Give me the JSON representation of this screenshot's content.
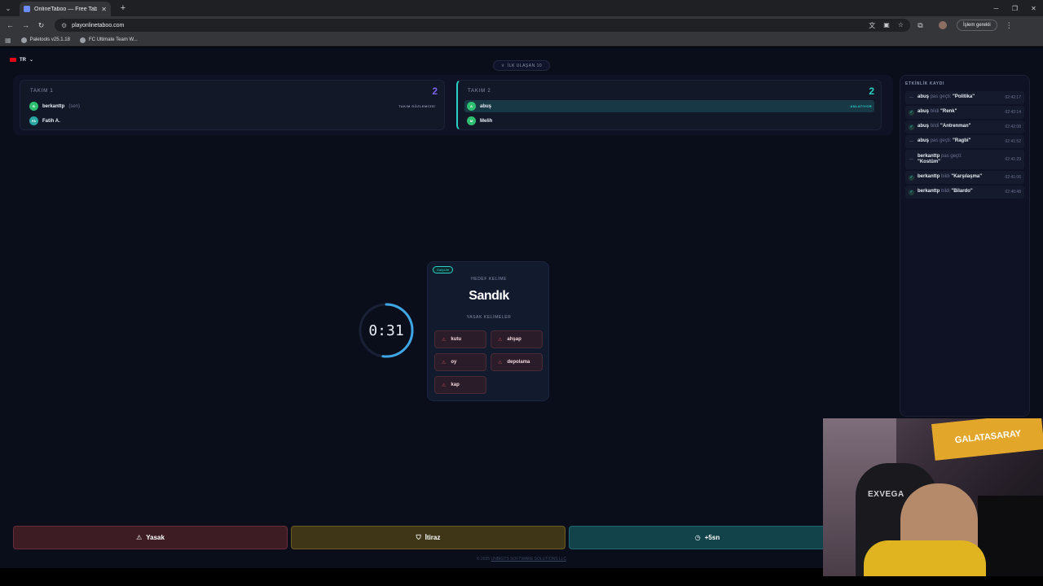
{
  "browser": {
    "tab_title": "OnlineTaboo — Free Taboo Ga",
    "url": "playonlinetaboo.com",
    "pending_label": "İşlem gerekli",
    "bookmarks": [
      "Paletools v25.1.18",
      "FC Ultimate Team W..."
    ]
  },
  "header": {
    "lang": "TR",
    "goal": "İLK ULAŞAN 10"
  },
  "teams": [
    {
      "name": "TAKIM 1",
      "score": "2",
      "color": "#7a64f2",
      "players": [
        {
          "initial": "B",
          "name": "berkanttp",
          "tag": "(sen)",
          "role": "TAKIM GÖZLEMCİSİ",
          "color": "#2fbf71"
        },
        {
          "initial": "FA",
          "name": "Fatih A.",
          "tag": "",
          "role": "",
          "color": "#2aa7a3"
        }
      ]
    },
    {
      "name": "TAKIM 2",
      "score": "2",
      "color": "#2ad1c4",
      "players": [
        {
          "initial": "A",
          "name": "abuş",
          "tag": "",
          "role": "ANLATIYOR",
          "color": "#2fbf71"
        },
        {
          "initial": "M",
          "name": "Melih",
          "tag": "",
          "role": "",
          "color": "#2fbf71"
        }
      ]
    }
  ],
  "log": {
    "title": "ETKİNLİK KAYDI",
    "items": [
      {
        "status": "pass",
        "user": "abuş",
        "action": "pas geçti:",
        "word": "\"Politika\"",
        "time": "02:42:17"
      },
      {
        "status": "ok",
        "user": "abuş",
        "action": "bildi",
        "word": "\"Renk\"",
        "time": "02:42:14"
      },
      {
        "status": "ok",
        "user": "abuş",
        "action": "bildi",
        "word": "\"Antrenman\"",
        "time": "02:42:08"
      },
      {
        "status": "pass",
        "user": "abuş",
        "action": "pas geçti:",
        "word": "\"Ragbi\"",
        "time": "02:41:52"
      },
      {
        "status": "pass",
        "user": "berkanttp",
        "action": "pas geçti:",
        "word": "\"Kostüm\"",
        "time": "02:41:29"
      },
      {
        "status": "ok",
        "user": "berkanttp",
        "action": "bildi",
        "word": "\"Karşılaşma\"",
        "time": "02:41:06"
      },
      {
        "status": "ok",
        "user": "berkanttp",
        "action": "bildi",
        "word": "\"Bilardo\"",
        "time": "02:40:48"
      }
    ]
  },
  "timer": {
    "text": "0:31",
    "progress": 0.52
  },
  "card": {
    "category": "DailyLife",
    "target_label": "HEDEF KELİME",
    "word": "Sandık",
    "taboo_label": "YASAK KELİMELER",
    "taboo_words": [
      "kutu",
      "ahşap",
      "oy",
      "depolama",
      "kap"
    ]
  },
  "actions": {
    "yasak": "Yasak",
    "itiraz": "İtiraz",
    "plus": "+5sn"
  },
  "footer": {
    "prefix": "© 2025",
    "company": "UNBIGTS SOFTWARE SOLUTIONS LLC"
  },
  "webcam": {
    "banner": "GALATASARAY",
    "brand": "EXVEGA"
  }
}
